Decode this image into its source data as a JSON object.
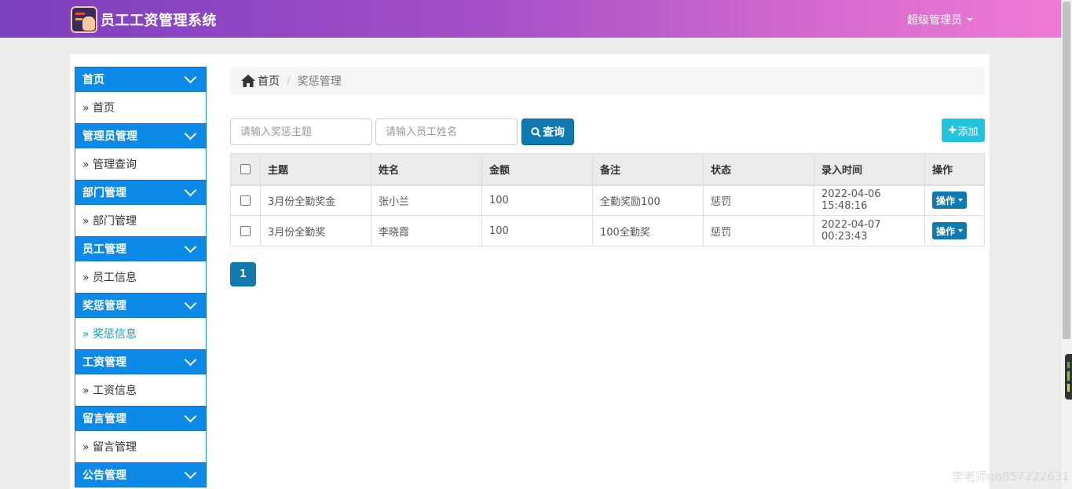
{
  "header": {
    "app_title": "员工工资管理系统",
    "user_label": "超级管理员"
  },
  "sidebar": {
    "sections": [
      {
        "title": "首页",
        "item": "» 首页"
      },
      {
        "title": "管理员管理",
        "item": "» 管理查询"
      },
      {
        "title": "部门管理",
        "item": "» 部门管理"
      },
      {
        "title": "员工管理",
        "item": "» 员工信息"
      },
      {
        "title": "奖惩管理",
        "item": "» 奖惩信息"
      },
      {
        "title": "工资管理",
        "item": "» 工资信息"
      },
      {
        "title": "留言管理",
        "item": "» 留言管理"
      },
      {
        "title": "公告管理",
        "item": ""
      }
    ],
    "active_item": "奖惩信息"
  },
  "breadcrumb": {
    "home": "首页",
    "current": "奖惩管理"
  },
  "search": {
    "subject_placeholder": "请输入奖惩主题",
    "name_placeholder": "请输入员工姓名",
    "query_label": "查询",
    "add_label": "添加"
  },
  "table": {
    "headers": [
      "主题",
      "姓名",
      "金额",
      "备注",
      "状态",
      "录入时间",
      "操作"
    ],
    "rows": [
      {
        "subject": "3月份全勤奖金",
        "name": "张小兰",
        "amount": "100",
        "remark": "全勤奖励100",
        "status": "惩罚",
        "time": "2022-04-06 15:48:16",
        "action": "操作"
      },
      {
        "subject": "3月份全勤奖",
        "name": "李晓霞",
        "amount": "100",
        "remark": "100全勤奖",
        "status": "惩罚",
        "time": "2022-04-07 00:23:43",
        "action": "操作"
      }
    ]
  },
  "pagination": {
    "current_page": "1"
  },
  "watermark": "李老师qq857222631",
  "colors": {
    "sidebar_head": "#0d8ae8",
    "primary_button": "#0f79b0",
    "add_button": "#22c3dc",
    "active_link": "#17a2b8"
  }
}
